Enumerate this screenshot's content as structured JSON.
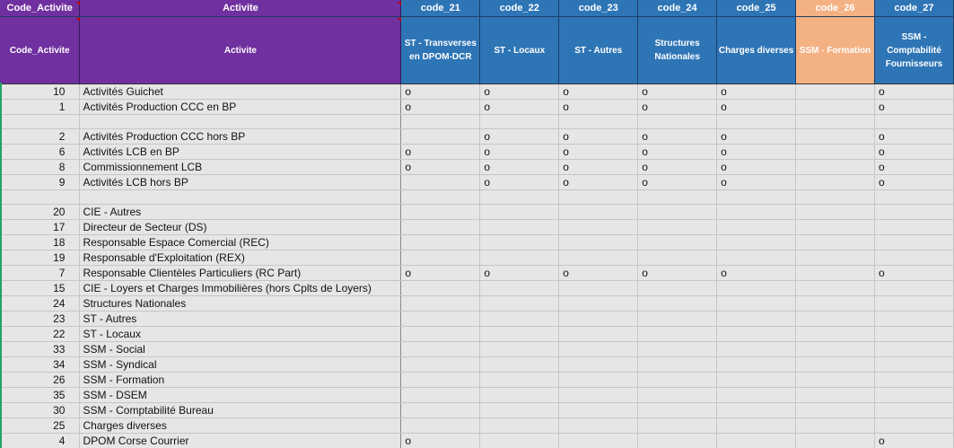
{
  "header_row1": [
    "Code_Activite",
    "Activite",
    "code_21",
    "code_22",
    "code_23",
    "code_24",
    "code_25",
    "code_26",
    "code_27"
  ],
  "header_row2": [
    "Code_Activite",
    "Activite",
    "ST - Transverses en DPOM-DCR",
    "ST - Locaux",
    "ST - Autres",
    "Structures Nationales",
    "Charges diverses",
    "SSM - Formation",
    "SSM - Comptabilité Fournisseurs"
  ],
  "rows": [
    {
      "code": "10",
      "name": "Activités Guichet",
      "marks": [
        "o",
        "o",
        "o",
        "o",
        "o",
        "",
        "o"
      ]
    },
    {
      "code": "1",
      "name": "Activités Production CCC en BP",
      "marks": [
        "o",
        "o",
        "o",
        "o",
        "o",
        "",
        "o"
      ]
    },
    {
      "code": "",
      "name": "",
      "marks": [
        "",
        "",
        "",
        "",
        "",
        "",
        ""
      ]
    },
    {
      "code": "2",
      "name": "Activités Production CCC hors BP",
      "marks": [
        "",
        "o",
        "o",
        "o",
        "o",
        "",
        "o"
      ]
    },
    {
      "code": "6",
      "name": "Activités LCB en BP",
      "marks": [
        "o",
        "o",
        "o",
        "o",
        "o",
        "",
        "o"
      ]
    },
    {
      "code": "8",
      "name": "Commissionnement LCB",
      "marks": [
        "o",
        "o",
        "o",
        "o",
        "o",
        "",
        "o"
      ]
    },
    {
      "code": "9",
      "name": "Activités LCB hors BP",
      "marks": [
        "",
        "o",
        "o",
        "o",
        "o",
        "",
        "o"
      ]
    },
    {
      "code": "",
      "name": "",
      "marks": [
        "",
        "",
        "",
        "",
        "",
        "",
        ""
      ]
    },
    {
      "code": "20",
      "name": "CIE - Autres",
      "marks": [
        "",
        "",
        "",
        "",
        "",
        "",
        ""
      ]
    },
    {
      "code": "17",
      "name": "Directeur de Secteur (DS)",
      "marks": [
        "",
        "",
        "",
        "",
        "",
        "",
        ""
      ]
    },
    {
      "code": "18",
      "name": "Responsable Espace Comercial (REC)",
      "marks": [
        "",
        "",
        "",
        "",
        "",
        "",
        ""
      ]
    },
    {
      "code": "19",
      "name": "Responsable d'Exploitation (REX)",
      "marks": [
        "",
        "",
        "",
        "",
        "",
        "",
        ""
      ]
    },
    {
      "code": "7",
      "name": "Responsable Clientèles Particuliers (RC Part)",
      "marks": [
        "o",
        "o",
        "o",
        "o",
        "o",
        "",
        "o"
      ]
    },
    {
      "code": "15",
      "name": "CIE - Loyers et Charges Immobilières (hors Cplts de Loyers)",
      "marks": [
        "",
        "",
        "",
        "",
        "",
        "",
        ""
      ]
    },
    {
      "code": "24",
      "name": "Structures Nationales",
      "marks": [
        "",
        "",
        "",
        "",
        "",
        "",
        ""
      ]
    },
    {
      "code": "23",
      "name": "ST - Autres",
      "marks": [
        "",
        "",
        "",
        "",
        "",
        "",
        ""
      ]
    },
    {
      "code": "22",
      "name": "ST - Locaux",
      "marks": [
        "",
        "",
        "",
        "",
        "",
        "",
        ""
      ]
    },
    {
      "code": "33",
      "name": "SSM - Social",
      "marks": [
        "",
        "",
        "",
        "",
        "",
        "",
        ""
      ]
    },
    {
      "code": "34",
      "name": "SSM - Syndical",
      "marks": [
        "",
        "",
        "",
        "",
        "",
        "",
        ""
      ]
    },
    {
      "code": "26",
      "name": "SSM - Formation",
      "marks": [
        "",
        "",
        "",
        "",
        "",
        "",
        ""
      ]
    },
    {
      "code": "35",
      "name": "SSM - DSEM",
      "marks": [
        "",
        "",
        "",
        "",
        "",
        "",
        ""
      ]
    },
    {
      "code": "30",
      "name": "SSM - Comptabilité Bureau",
      "marks": [
        "",
        "",
        "",
        "",
        "",
        "",
        ""
      ]
    },
    {
      "code": "25",
      "name": "Charges diverses",
      "marks": [
        "",
        "",
        "",
        "",
        "",
        "",
        ""
      ]
    },
    {
      "code": "4",
      "name": "DPOM Corse Courrier",
      "marks": [
        "o",
        "",
        "",
        "",
        "",
        "",
        "o"
      ]
    }
  ],
  "colors": {
    "purple": "#7030a0",
    "blue": "#2e75b6",
    "orange": "#f4b183",
    "grid_bg": "#e6e6e6"
  }
}
